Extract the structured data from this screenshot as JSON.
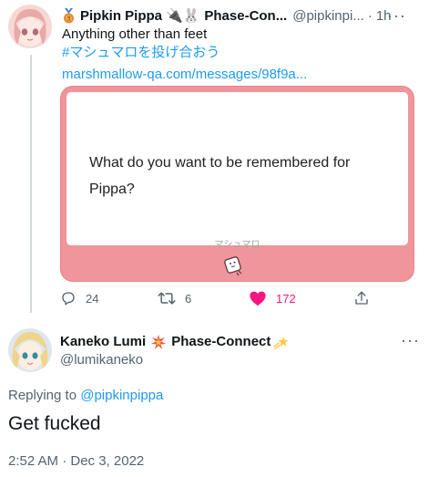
{
  "tweet": {
    "author": {
      "display_name": "Pipkin Pippa",
      "emojis": "🔌🐰",
      "affiliation": "Phase-Con...",
      "handle": "@pipkinpi...",
      "time": "1h"
    },
    "text_lines": [
      "Anything other than feet"
    ],
    "hashtag": "#マシュマロを投げ合おう",
    "link": "marshmallow-qa.com/messages/98f9a...",
    "card": {
      "question": "What do you want to be remembered for Pippa?",
      "footer_label": "マシュマロ",
      "icon": "marshmallow-icon",
      "accent_color": "#f0959b"
    },
    "actions": {
      "replies": "24",
      "retweets": "6",
      "likes": "172"
    }
  },
  "reply": {
    "author": {
      "display_name": "Kaneko Lumi",
      "affiliation": "Phase-Connect",
      "handle": "@lumikaneko"
    },
    "replying_prefix": "Replying to",
    "replying_to": "@pipkinpippa",
    "text": "Get fucked",
    "timestamp": "2:52 AM · Dec 3, 2022"
  }
}
